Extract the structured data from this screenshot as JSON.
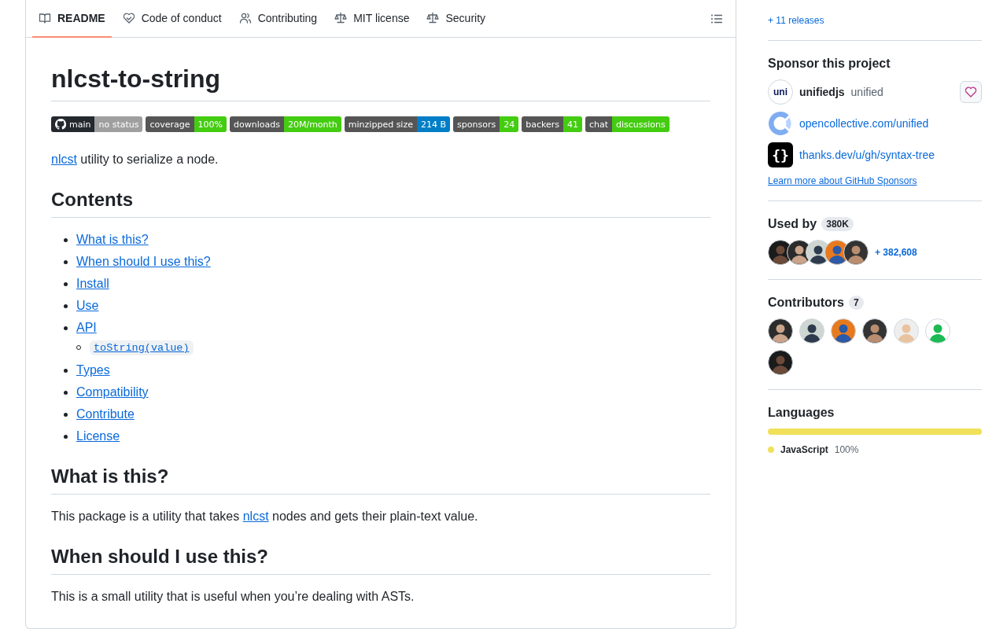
{
  "tabs": [
    {
      "label": "README",
      "selected": true
    },
    {
      "label": "Code of conduct",
      "selected": false
    },
    {
      "label": "Contributing",
      "selected": false
    },
    {
      "label": "MIT license",
      "selected": false
    },
    {
      "label": "Security",
      "selected": false
    }
  ],
  "readme": {
    "title": "nlcst-to-string",
    "badges": [
      {
        "label": "main",
        "value": "no status",
        "color": "#9f9f9f",
        "kind": "github"
      },
      {
        "label": "coverage",
        "value": "100%",
        "color": "#44cc11",
        "kind": "plain"
      },
      {
        "label": "downloads",
        "value": "20M/month",
        "color": "#44cc11",
        "kind": "plain"
      },
      {
        "label": "minzipped size",
        "value": "214 B",
        "color": "#007ec6",
        "kind": "plain"
      },
      {
        "label": "sponsors",
        "value": "24",
        "color": "#44cc11",
        "kind": "plain"
      },
      {
        "label": "backers",
        "value": "41",
        "color": "#44cc11",
        "kind": "plain"
      },
      {
        "label": "chat",
        "value": "discussions",
        "color": "#44cc11",
        "kind": "plain"
      }
    ],
    "blocks": [
      {
        "kind": "paragraph",
        "parts": [
          {
            "text": "nlcst",
            "kind": "link"
          },
          {
            "text": " utility to serialize a node.",
            "kind": "text"
          }
        ]
      },
      {
        "kind": "heading",
        "text": "Contents"
      },
      {
        "kind": "list",
        "items": [
          {
            "text": "What is this?",
            "kind": "text"
          },
          {
            "text": "When should I use this?",
            "kind": "text"
          },
          {
            "text": "Install",
            "kind": "text"
          },
          {
            "text": "Use",
            "kind": "text"
          },
          {
            "text": "API",
            "kind": "text",
            "children": [
              {
                "text": "toString(value)",
                "kind": "code"
              }
            ]
          },
          {
            "text": "Types",
            "kind": "text"
          },
          {
            "text": "Compatibility",
            "kind": "text"
          },
          {
            "text": "Contribute",
            "kind": "text"
          },
          {
            "text": "License",
            "kind": "text"
          }
        ]
      },
      {
        "kind": "heading",
        "text": "What is this?"
      },
      {
        "kind": "paragraph",
        "parts": [
          {
            "text": "This package is a utility that takes ",
            "kind": "text"
          },
          {
            "text": "nlcst",
            "kind": "link"
          },
          {
            "text": " nodes and gets their plain-text value.",
            "kind": "text"
          }
        ]
      },
      {
        "kind": "heading",
        "text": "When should I use this?"
      },
      {
        "kind": "paragraph",
        "parts": [
          {
            "text": "This is a small utility that is useful when you’re dealing with ASTs.",
            "kind": "text"
          }
        ]
      }
    ]
  },
  "sidebar": {
    "releases_link": "+ 11 releases",
    "sponsor": {
      "title": "Sponsor this project",
      "maintainer": {
        "logo_text": "uni",
        "name": "unifiedjs",
        "handle": "unified"
      },
      "links": [
        {
          "text": "opencollective.com/unified",
          "kind": "ring"
        },
        {
          "text": "thanks.dev/u/gh/syntax-tree",
          "kind": "braces",
          "logo_text": "{}"
        }
      ],
      "learn_more": "Learn more about GitHub Sponsors"
    },
    "used_by": {
      "title": "Used by",
      "count": "380K",
      "more": "+ 382,608"
    },
    "contributors": {
      "title": "Contributors",
      "count": "7"
    },
    "languages": {
      "title": "Languages",
      "items": [
        {
          "name": "JavaScript",
          "percent": "100%",
          "color": "#f1e05a",
          "level": 1
        }
      ]
    }
  }
}
